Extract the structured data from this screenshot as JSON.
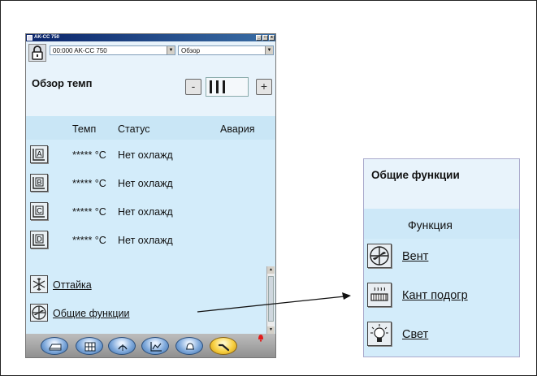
{
  "window": {
    "title": "AK-CC 750",
    "min_label": "_",
    "max_label": "□",
    "close_label": "x"
  },
  "toolbar": {
    "lock_icon": "lock-icon",
    "device_select": "00:000 AK-CC 750",
    "view_select": "Обзор"
  },
  "overview": {
    "title": "Обзор темп",
    "zoom_minus": "-",
    "zoom_plus": "+",
    "columns": {
      "temp": "Темп",
      "status": "Статус",
      "alarm": "Авария"
    },
    "rows": [
      {
        "icon": "case-a-icon",
        "letter": "A",
        "temp": "***** °C",
        "status": "Нет охлажд"
      },
      {
        "icon": "case-b-icon",
        "letter": "B",
        "temp": "***** °C",
        "status": "Нет охлажд"
      },
      {
        "icon": "case-c-icon",
        "letter": "C",
        "temp": "***** °C",
        "status": "Нет охлажд"
      },
      {
        "icon": "case-d-icon",
        "letter": "D",
        "temp": "***** °C",
        "status": "Нет охлажд"
      }
    ],
    "links": [
      {
        "icon": "defrost-icon",
        "label": "Оттайка"
      },
      {
        "icon": "fan-icon",
        "label": "Общие функции"
      }
    ]
  },
  "navbar": {
    "buttons": [
      "display-case-icon",
      "grid-icon",
      "defrost-icon",
      "graph-icon",
      "alarm-bell-icon",
      "service-wrench-icon"
    ],
    "active_index": 5,
    "alarm_color": "#e21b1b"
  },
  "functions_panel": {
    "title": "Общие функции",
    "column": "Функция",
    "items": [
      {
        "icon": "fan-icon",
        "label": "Вент"
      },
      {
        "icon": "rail-heat-icon",
        "label": "Кант подогр"
      },
      {
        "icon": "light-bulb-icon",
        "label": "Свет"
      }
    ]
  },
  "colors": {
    "background": "#e8f3fb",
    "header_band": "#c9e6f6",
    "list_band": "#d3ecfa",
    "accent_active": "#f7cf3f",
    "nav_blue": "#7fa9db"
  }
}
